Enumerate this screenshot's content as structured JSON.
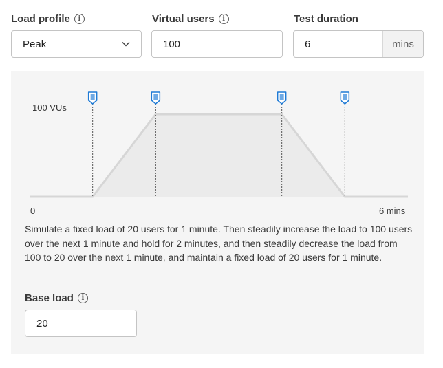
{
  "form": {
    "load_profile": {
      "label": "Load profile",
      "value": "Peak",
      "info_icon": "info-icon",
      "dropdown_icon": "chevron-down-icon"
    },
    "virtual_users": {
      "label": "Virtual users",
      "value": "100",
      "info_icon": "info-icon"
    },
    "test_duration": {
      "label": "Test duration",
      "value": "6",
      "unit": "mins"
    }
  },
  "chart": {
    "y_label": "100 VUs",
    "x_start_label": "0",
    "x_end_label": "6 mins",
    "marker_icon": "document-marker-icon",
    "colors": {
      "line": "#d6d6d6",
      "fill": "#ebebeb",
      "marker": "#1f7bd6",
      "dash": "#555555"
    }
  },
  "chart_data": {
    "type": "area",
    "x": [
      0,
      1,
      2,
      4,
      5,
      6
    ],
    "y": [
      20,
      20,
      100,
      100,
      20,
      20
    ],
    "xlim": [
      0,
      6
    ],
    "ylim": [
      0,
      100
    ],
    "markers_x": [
      1,
      2,
      4,
      5
    ]
  },
  "description": "Simulate a fixed load of 20 users for 1 minute. Then steadily increase the load to 100 users over the next 1 minute and hold for 2 minutes, and then steadily decrease the load from 100 to 20 over the next 1 minute, and maintain a fixed load of 20 users for 1 minute.",
  "base_load": {
    "label": "Base load",
    "value": "20",
    "info_icon": "info-icon"
  }
}
